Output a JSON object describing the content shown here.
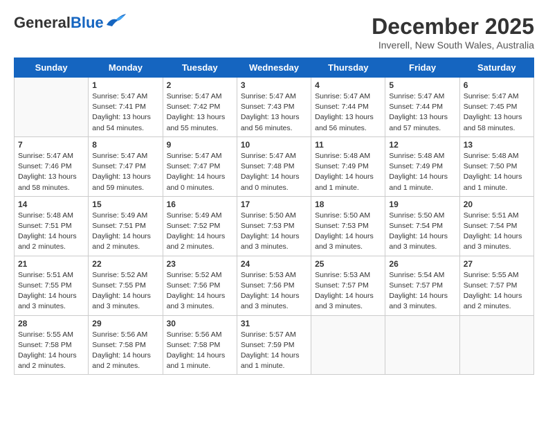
{
  "header": {
    "logo_general": "General",
    "logo_blue": "Blue",
    "month_title": "December 2025",
    "subtitle": "Inverell, New South Wales, Australia"
  },
  "weekdays": [
    "Sunday",
    "Monday",
    "Tuesday",
    "Wednesday",
    "Thursday",
    "Friday",
    "Saturday"
  ],
  "weeks": [
    [
      {
        "day": "",
        "empty": true
      },
      {
        "day": "1",
        "sunrise": "5:47 AM",
        "sunset": "7:41 PM",
        "daylight": "13 hours and 54 minutes."
      },
      {
        "day": "2",
        "sunrise": "5:47 AM",
        "sunset": "7:42 PM",
        "daylight": "13 hours and 55 minutes."
      },
      {
        "day": "3",
        "sunrise": "5:47 AM",
        "sunset": "7:43 PM",
        "daylight": "13 hours and 56 minutes."
      },
      {
        "day": "4",
        "sunrise": "5:47 AM",
        "sunset": "7:44 PM",
        "daylight": "13 hours and 56 minutes."
      },
      {
        "day": "5",
        "sunrise": "5:47 AM",
        "sunset": "7:44 PM",
        "daylight": "13 hours and 57 minutes."
      },
      {
        "day": "6",
        "sunrise": "5:47 AM",
        "sunset": "7:45 PM",
        "daylight": "13 hours and 58 minutes."
      }
    ],
    [
      {
        "day": "7",
        "sunrise": "5:47 AM",
        "sunset": "7:46 PM",
        "daylight": "13 hours and 58 minutes."
      },
      {
        "day": "8",
        "sunrise": "5:47 AM",
        "sunset": "7:47 PM",
        "daylight": "13 hours and 59 minutes."
      },
      {
        "day": "9",
        "sunrise": "5:47 AM",
        "sunset": "7:47 PM",
        "daylight": "14 hours and 0 minutes."
      },
      {
        "day": "10",
        "sunrise": "5:47 AM",
        "sunset": "7:48 PM",
        "daylight": "14 hours and 0 minutes."
      },
      {
        "day": "11",
        "sunrise": "5:48 AM",
        "sunset": "7:49 PM",
        "daylight": "14 hours and 1 minute."
      },
      {
        "day": "12",
        "sunrise": "5:48 AM",
        "sunset": "7:49 PM",
        "daylight": "14 hours and 1 minute."
      },
      {
        "day": "13",
        "sunrise": "5:48 AM",
        "sunset": "7:50 PM",
        "daylight": "14 hours and 1 minute."
      }
    ],
    [
      {
        "day": "14",
        "sunrise": "5:48 AM",
        "sunset": "7:51 PM",
        "daylight": "14 hours and 2 minutes."
      },
      {
        "day": "15",
        "sunrise": "5:49 AM",
        "sunset": "7:51 PM",
        "daylight": "14 hours and 2 minutes."
      },
      {
        "day": "16",
        "sunrise": "5:49 AM",
        "sunset": "7:52 PM",
        "daylight": "14 hours and 2 minutes."
      },
      {
        "day": "17",
        "sunrise": "5:50 AM",
        "sunset": "7:53 PM",
        "daylight": "14 hours and 3 minutes."
      },
      {
        "day": "18",
        "sunrise": "5:50 AM",
        "sunset": "7:53 PM",
        "daylight": "14 hours and 3 minutes."
      },
      {
        "day": "19",
        "sunrise": "5:50 AM",
        "sunset": "7:54 PM",
        "daylight": "14 hours and 3 minutes."
      },
      {
        "day": "20",
        "sunrise": "5:51 AM",
        "sunset": "7:54 PM",
        "daylight": "14 hours and 3 minutes."
      }
    ],
    [
      {
        "day": "21",
        "sunrise": "5:51 AM",
        "sunset": "7:55 PM",
        "daylight": "14 hours and 3 minutes."
      },
      {
        "day": "22",
        "sunrise": "5:52 AM",
        "sunset": "7:55 PM",
        "daylight": "14 hours and 3 minutes."
      },
      {
        "day": "23",
        "sunrise": "5:52 AM",
        "sunset": "7:56 PM",
        "daylight": "14 hours and 3 minutes."
      },
      {
        "day": "24",
        "sunrise": "5:53 AM",
        "sunset": "7:56 PM",
        "daylight": "14 hours and 3 minutes."
      },
      {
        "day": "25",
        "sunrise": "5:53 AM",
        "sunset": "7:57 PM",
        "daylight": "14 hours and 3 minutes."
      },
      {
        "day": "26",
        "sunrise": "5:54 AM",
        "sunset": "7:57 PM",
        "daylight": "14 hours and 3 minutes."
      },
      {
        "day": "27",
        "sunrise": "5:55 AM",
        "sunset": "7:57 PM",
        "daylight": "14 hours and 2 minutes."
      }
    ],
    [
      {
        "day": "28",
        "sunrise": "5:55 AM",
        "sunset": "7:58 PM",
        "daylight": "14 hours and 2 minutes."
      },
      {
        "day": "29",
        "sunrise": "5:56 AM",
        "sunset": "7:58 PM",
        "daylight": "14 hours and 2 minutes."
      },
      {
        "day": "30",
        "sunrise": "5:56 AM",
        "sunset": "7:58 PM",
        "daylight": "14 hours and 1 minute."
      },
      {
        "day": "31",
        "sunrise": "5:57 AM",
        "sunset": "7:59 PM",
        "daylight": "14 hours and 1 minute."
      },
      {
        "day": "",
        "empty": true
      },
      {
        "day": "",
        "empty": true
      },
      {
        "day": "",
        "empty": true
      }
    ]
  ]
}
